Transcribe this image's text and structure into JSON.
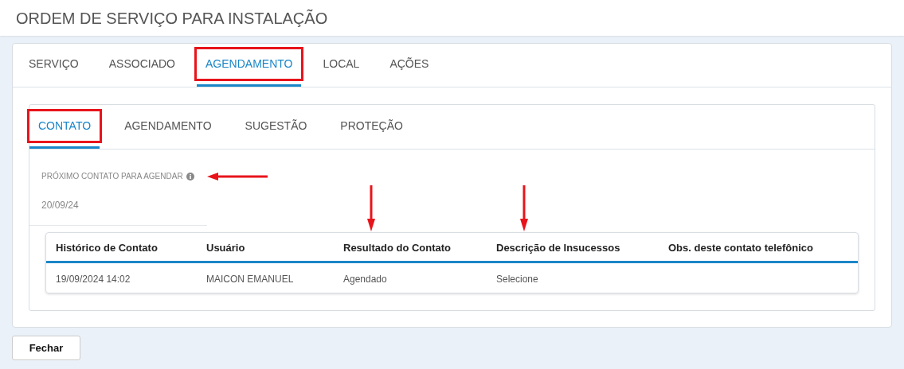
{
  "header": {
    "title": "ORDEM DE SERVIÇO PARA INSTALAÇÃO"
  },
  "tabs": [
    {
      "label": "SERVIÇO",
      "selected": false,
      "highlighted": false
    },
    {
      "label": "ASSOCIADO",
      "selected": false,
      "highlighted": false
    },
    {
      "label": "AGENDAMENTO",
      "selected": true,
      "highlighted": true
    },
    {
      "label": "LOCAL",
      "selected": false,
      "highlighted": false
    },
    {
      "label": "AÇÕES",
      "selected": false,
      "highlighted": false
    }
  ],
  "subtabs": [
    {
      "label": "CONTATO",
      "selected": true,
      "highlighted": true
    },
    {
      "label": "AGENDAMENTO",
      "selected": false,
      "highlighted": false
    },
    {
      "label": "SUGESTÃO",
      "selected": false,
      "highlighted": false
    },
    {
      "label": "PROTEÇÃO",
      "selected": false,
      "highlighted": false
    }
  ],
  "next_contact": {
    "label": "PRÓXIMO CONTATO PARA AGENDAR",
    "marked_by_arrow": true,
    "value": "20/09/24"
  },
  "table": {
    "columns": [
      {
        "label": "Histórico de Contato",
        "marked_by_arrow": false
      },
      {
        "label": "Usuário",
        "marked_by_arrow": false
      },
      {
        "label": "Resultado do Contato",
        "marked_by_arrow": true
      },
      {
        "label": "Descrição de Insucessos",
        "marked_by_arrow": true
      },
      {
        "label": "Obs. deste contato telefônico",
        "marked_by_arrow": false
      }
    ],
    "rows": [
      [
        "19/09/2024 14:02",
        "MAICON EMANUEL",
        "Agendado",
        "Selecione"
      ]
    ]
  },
  "buttons": [
    "Fechar"
  ]
}
